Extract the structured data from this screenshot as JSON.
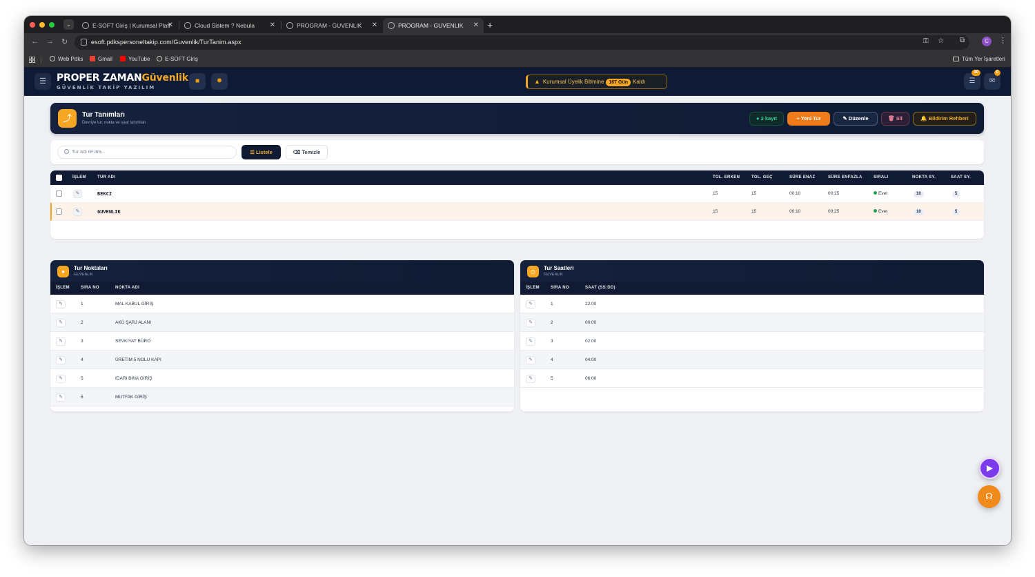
{
  "browser": {
    "tabs": [
      {
        "label": "E-SOFT Giriş | Kurumsal Platf"
      },
      {
        "label": "Cloud Sistem ? Nebula"
      },
      {
        "label": "PROGRAM - GUVENLIK"
      },
      {
        "label": "PROGRAM - GUVENLIK"
      }
    ],
    "url": "esoft.pdkspersoneltakip.com/Guvenlik/TurTanim.aspx",
    "bookmarks": [
      {
        "label": "Web Pdks"
      },
      {
        "label": "Gmail"
      },
      {
        "label": "YouTube"
      },
      {
        "label": "E-SOFT Giriş"
      }
    ],
    "bookmarks_all": "Tüm Yer İşaretleri",
    "profile_initial": "C"
  },
  "header": {
    "brand_main": "PROPER ZAMAN",
    "brand_accent": "Güvenlik",
    "brand_sub": "GÜVENLİK TAKİP YAZILIM",
    "membership_prefix": "Kurumsal Üyelik Bitimine",
    "membership_days": "167 Gün",
    "membership_suffix": "Kaldı",
    "notif_count": "30",
    "mail_count": "0"
  },
  "page": {
    "title": "Tur Tanımları",
    "subtitle": "Devriye tur, nokta ve saat tanımları",
    "record_count": "2 kayıt",
    "btn_new": "Yeni Tur",
    "btn_edit": "Düzenle",
    "btn_delete": "Sil",
    "btn_guide": "Bildirim Rehberi"
  },
  "search": {
    "placeholder": "Tur adı ile ara...",
    "btn_list": "Listele",
    "btn_clear": "Temizle"
  },
  "tours": {
    "columns": {
      "action": "İŞLEM",
      "name": "TUR ADI",
      "tol_early": "TOL. ERKEN",
      "tol_late": "TOL. GEÇ",
      "min_time": "SÜRE ENAZ",
      "max_time": "SÜRE ENFAZLA",
      "ordered": "SIRALI",
      "points": "NOKTA SY.",
      "hours": "SAAT SY."
    },
    "rows": [
      {
        "name": "BEKCI",
        "tol_early": "15",
        "tol_late": "15",
        "min_time": "00:10",
        "max_time": "00:25",
        "ordered": "Evet",
        "points": "10",
        "hours": "5"
      },
      {
        "name": "GUVENLIK",
        "tol_early": "15",
        "tol_late": "15",
        "min_time": "00:10",
        "max_time": "00:25",
        "ordered": "Evet",
        "points": "10",
        "hours": "5"
      }
    ]
  },
  "points_panel": {
    "title": "Tur Noktaları",
    "subtitle": "GUVENLIK",
    "columns": {
      "action": "İŞLEM",
      "order": "SIRA NO",
      "name": "NOKTA ADI"
    },
    "rows": [
      {
        "order": "1",
        "name": "MAL KABUL GİRİŞ"
      },
      {
        "order": "2",
        "name": "AKÜ ŞARJ ALANI"
      },
      {
        "order": "3",
        "name": "SEVKIYAT BÜRO"
      },
      {
        "order": "4",
        "name": "ÜRETİM 5 NOLU KAPI"
      },
      {
        "order": "5",
        "name": "IDARI BİNA GİRİŞ"
      },
      {
        "order": "6",
        "name": "MUTFAK GİRİŞ"
      }
    ]
  },
  "hours_panel": {
    "title": "Tur Saatleri",
    "subtitle": "GUVENLIK",
    "columns": {
      "action": "İŞLEM",
      "order": "SIRA NO",
      "time": "SAAT (SS:DD)"
    },
    "rows": [
      {
        "order": "1",
        "time": "22:00"
      },
      {
        "order": "2",
        "time": "00:00"
      },
      {
        "order": "3",
        "time": "02:00"
      },
      {
        "order": "4",
        "time": "04:00"
      },
      {
        "order": "5",
        "time": "06:00"
      }
    ]
  },
  "colors": {
    "navy": "#101b33",
    "accent_orange": "#f5a623",
    "success_green": "#22a24b"
  }
}
